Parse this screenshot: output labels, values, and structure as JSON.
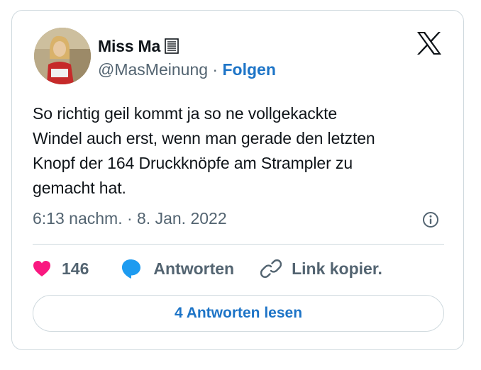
{
  "author": {
    "display_name": "Miss Ma",
    "handle": "@MasMeinung",
    "separator": " · ",
    "follow_label": "Folgen"
  },
  "tweet": {
    "text": "So richtig geil kommt ja so ne vollgekackte\nWindel auch erst, wenn man gerade den letzten\nKnopf der 164 Druckknöpfe am Strampler zu\ngemacht hat.",
    "timestamp": "6:13 nachm. · 8. Jan. 2022"
  },
  "actions": {
    "like_count": "146",
    "reply_label": "Antworten",
    "copy_label": "Link kopier."
  },
  "read_replies_label": "4 Antworten lesen",
  "colors": {
    "like": "#f91880",
    "reply": "#1d9bf0",
    "link": "#1d74c7",
    "secondary_text": "#536471",
    "border": "#cfd9de"
  },
  "icons": {
    "logo": "x-logo-icon",
    "name_glyph": "book-icon",
    "info": "info-icon",
    "like": "heart-icon",
    "reply": "speech-bubble-icon",
    "copy": "link-icon"
  }
}
